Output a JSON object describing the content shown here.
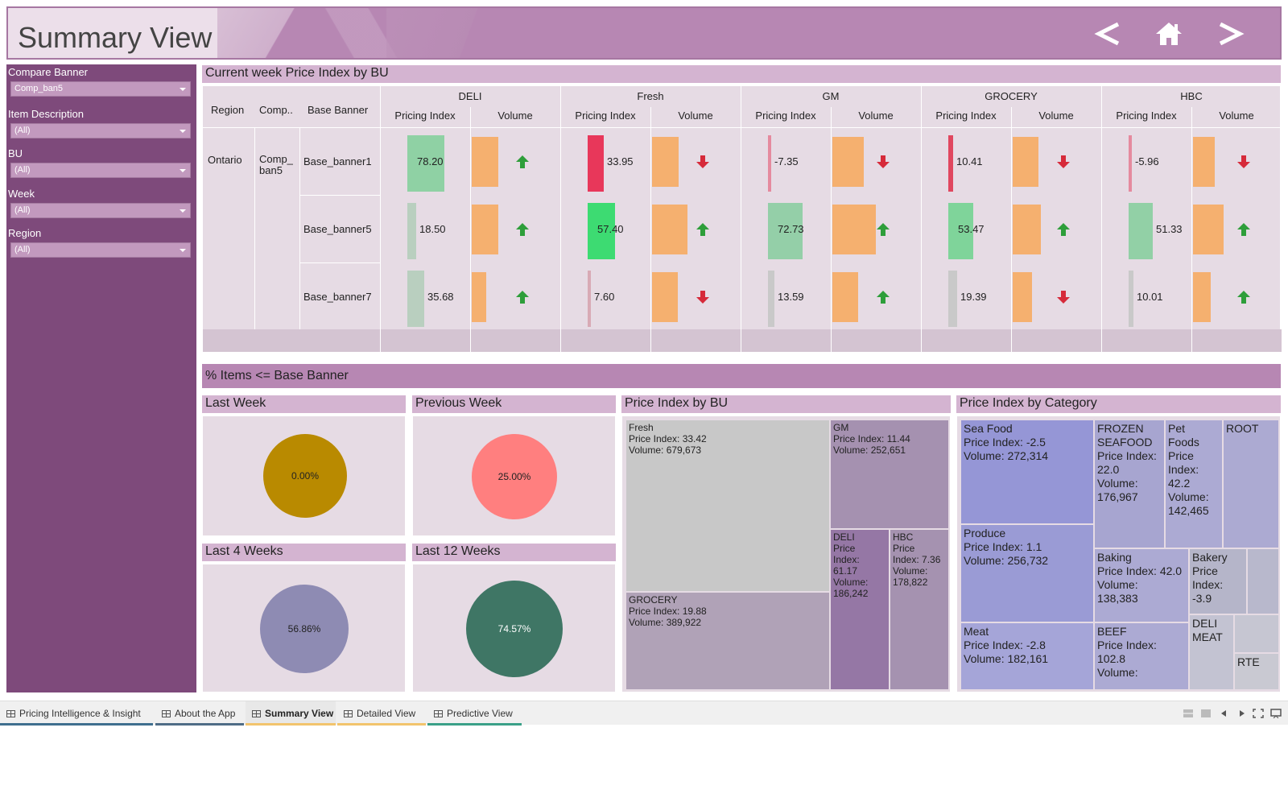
{
  "header": {
    "title": "Summary View",
    "nav": {
      "prev_icon": "chevron-left-icon",
      "home_icon": "home-icon",
      "next_icon": "chevron-right-icon"
    }
  },
  "sidebar": {
    "filters": [
      {
        "label": "Compare Banner",
        "value": "Comp_ban5"
      },
      {
        "label": "Item Description",
        "value": "(All)"
      },
      {
        "label": "BU",
        "value": "(All)"
      },
      {
        "label": "Week",
        "value": "(All)"
      },
      {
        "label": "Region",
        "value": "(All)"
      }
    ]
  },
  "price_table": {
    "title": "Current week Price Index by BU",
    "row_headers": {
      "region": "Region",
      "comp": "Comp..",
      "base": "Base Banner"
    },
    "bus": [
      "DELI",
      "Fresh",
      "GM",
      "GROCERY",
      "HBC"
    ],
    "sub_headers": {
      "pricing_index": "Pricing Index",
      "volume": "Volume"
    },
    "region": "Ontario",
    "comp": "Comp_\nban5",
    "rows": [
      {
        "banner": "Base_banner1",
        "cells": [
          {
            "pi": "78.20",
            "pi_value": 78.2,
            "pi_color": "#8fd1a4",
            "vol_fraction": 0.57,
            "trend": "up"
          },
          {
            "pi": "33.95",
            "pi_value": 33.95,
            "pi_color": "#e8375a",
            "vol_fraction": 0.57,
            "trend": "down"
          },
          {
            "pi": "-7.35",
            "pi_value": -7.35,
            "pi_color": "#e58a9e",
            "vol_fraction": 0.67,
            "trend": "down"
          },
          {
            "pi": "10.41",
            "pi_value": 10.41,
            "pi_color": "#e0475f",
            "vol_fraction": 0.55,
            "trend": "down"
          },
          {
            "pi": "-5.96",
            "pi_value": -5.96,
            "pi_color": "#e58a9e",
            "vol_fraction": 0.47,
            "trend": "down"
          }
        ]
      },
      {
        "banner": "Base_banner5",
        "cells": [
          {
            "pi": "18.50",
            "pi_value": 18.5,
            "pi_color": "#b9cfbf",
            "vol_fraction": 0.57,
            "trend": "up"
          },
          {
            "pi": "57.40",
            "pi_value": 57.4,
            "pi_color": "#3ddb72",
            "vol_fraction": 0.76,
            "trend": "up"
          },
          {
            "pi": "72.73",
            "pi_value": 72.73,
            "pi_color": "#94cfa8",
            "vol_fraction": 0.93,
            "trend": "up"
          },
          {
            "pi": "53.47",
            "pi_value": 53.47,
            "pi_color": "#7fd49a",
            "vol_fraction": 0.6,
            "trend": "up"
          },
          {
            "pi": "51.33",
            "pi_value": 51.33,
            "pi_color": "#92d0a6",
            "vol_fraction": 0.65,
            "trend": "up"
          }
        ]
      },
      {
        "banner": "Base_banner7",
        "cells": [
          {
            "pi": "35.68",
            "pi_value": 35.68,
            "pi_color": "#b9cfbf",
            "vol_fraction": 0.31,
            "trend": "up"
          },
          {
            "pi": "7.60",
            "pi_value": 7.6,
            "pi_color": "#d8aab5",
            "vol_fraction": 0.56,
            "trend": "down"
          },
          {
            "pi": "13.59",
            "pi_value": 13.59,
            "pi_color": "#c9c9c9",
            "vol_fraction": 0.55,
            "trend": "up"
          },
          {
            "pi": "19.39",
            "pi_value": 19.39,
            "pi_color": "#c9c9c9",
            "vol_fraction": 0.42,
            "trend": "down"
          },
          {
            "pi": "10.01",
            "pi_value": 10.01,
            "pi_color": "#c9c9c9",
            "vol_fraction": 0.38,
            "trend": "up"
          }
        ]
      }
    ],
    "colors": {
      "volume": "#f5b06f",
      "up": "#2e9e3a",
      "down": "#d62a3a"
    }
  },
  "items_section": {
    "title": "% Items <= Base Banner",
    "pies": [
      {
        "title": "Last Week",
        "value": "0.00%",
        "color": "#b98a00"
      },
      {
        "title": "Previous Week",
        "value": "25.00%",
        "color": "#ff7f7f"
      },
      {
        "title": "Last 4 Weeks",
        "value": "56.86%",
        "color": "#8e8bb3"
      },
      {
        "title": "Last 12 Weeks",
        "value": "74.57%",
        "color": "#3f7665"
      }
    ]
  },
  "bu_treemap": {
    "title": "Price Index by BU",
    "items": [
      {
        "name": "Fresh",
        "pi": "Price Index: 33.42",
        "vol": "Volume: 679,673",
        "color": "#c8c8c8"
      },
      {
        "name": "GM",
        "pi": "Price Index: 11.44",
        "vol": "Volume: 252,651",
        "color": "#a591b0"
      },
      {
        "name": "GROCERY",
        "pi": "Price Index: 19.88",
        "vol": "Volume: 389,922",
        "color": "#b0a2b7"
      },
      {
        "name": "DELI",
        "pi": "Price\nIndex:\n61.17",
        "vol": "Volume:\n186,242",
        "color": "#9577a5"
      },
      {
        "name": "HBC",
        "pi": "Price\nIndex: 7.36",
        "vol": "Volume:\n178,822",
        "color": "#a592b0"
      }
    ]
  },
  "cat_treemap": {
    "title": "Price Index by Category",
    "items": [
      {
        "name": "Sea Food",
        "pi": "Price Index: -2.5",
        "vol": "Volume: 272,314",
        "color": "#9596d6"
      },
      {
        "name": "FROZEN\nSEAFOOD",
        "pi": "Price Index:\n22.0",
        "vol": "Volume:\n176,967",
        "color": "#a7a5d0"
      },
      {
        "name": "Pet\nFoods",
        "pi": "Price\nIndex:\n42.2",
        "vol": "Volume:\n142,465",
        "color": "#acaad3"
      },
      {
        "name": "ROOT",
        "pi": "",
        "vol": "",
        "color": "#acaad2"
      },
      {
        "name": "Produce",
        "pi": "Price Index: 1.1",
        "vol": "Volume: 256,732",
        "color": "#9a9bd5"
      },
      {
        "name": "Baking",
        "pi": "Price Index: 42.0",
        "vol": "Volume:\n138,383",
        "color": "#acaad3"
      },
      {
        "name": "Bakery",
        "pi": "Price\nIndex:\n-3.9",
        "vol": "",
        "color": "#b5b5c9"
      },
      {
        "name": "Meat",
        "pi": "Price Index: -2.8",
        "vol": "Volume: 182,161",
        "color": "#a5a5d8"
      },
      {
        "name": "BEEF",
        "pi": "Price Index:\n102.8",
        "vol": "Volume:",
        "color": "#acaad3"
      },
      {
        "name": "DELI\nMEAT",
        "pi": "",
        "vol": "",
        "color": "#c3c3d2"
      },
      {
        "name": "RTE",
        "pi": "",
        "vol": "",
        "color": "#c9c9d2"
      }
    ]
  },
  "tabs": [
    {
      "label": "Pricing Intelligence & Insight",
      "underline": "#3f6f8f"
    },
    {
      "label": "About the App",
      "underline": "#4f6c86"
    },
    {
      "label": "Summary View",
      "underline": "#f2c46d"
    },
    {
      "label": "Detailed View",
      "underline": "#f2c46d"
    },
    {
      "label": "Predictive View",
      "underline": "#3aa088"
    }
  ]
}
